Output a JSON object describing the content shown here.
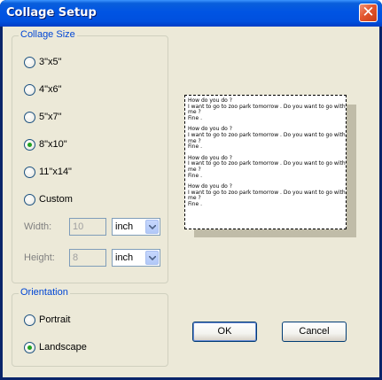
{
  "window": {
    "title": "Collage Setup"
  },
  "collage_size": {
    "label": "Collage Size",
    "options": [
      {
        "label": "3\"x5\"",
        "checked": false
      },
      {
        "label": "4\"x6\"",
        "checked": false
      },
      {
        "label": "5\"x7\"",
        "checked": false
      },
      {
        "label": "8\"x10\"",
        "checked": true
      },
      {
        "label": "11\"x14\"",
        "checked": false
      },
      {
        "label": "Custom",
        "checked": false
      }
    ],
    "width": {
      "label": "Width:",
      "value": "10",
      "unit": "inch"
    },
    "height": {
      "label": "Height:",
      "value": "8",
      "unit": "inch"
    }
  },
  "orientation": {
    "label": "Orientation",
    "options": [
      {
        "label": "Portrait",
        "checked": false
      },
      {
        "label": "Landscape",
        "checked": true
      }
    ]
  },
  "preview": {
    "blocks": [
      "How do you do ?\nI want to go to zoo park tomorrow . Do you want to go with me ?\nFine .",
      "How do you do ?\nI want to go to zoo park tomorrow . Do you want to go with me ?\nFine .",
      "How do you do ?\nI want to go to zoo park tomorrow . Do you want to go with me ?\nFine .",
      "How do you do ?\nI want to go to zoo park tomorrow . Do you want to go with me ?\nFine ."
    ]
  },
  "buttons": {
    "ok": "OK",
    "cancel": "Cancel"
  },
  "icons": {
    "close": "close-icon",
    "dropdown": "chevron-down-icon"
  }
}
